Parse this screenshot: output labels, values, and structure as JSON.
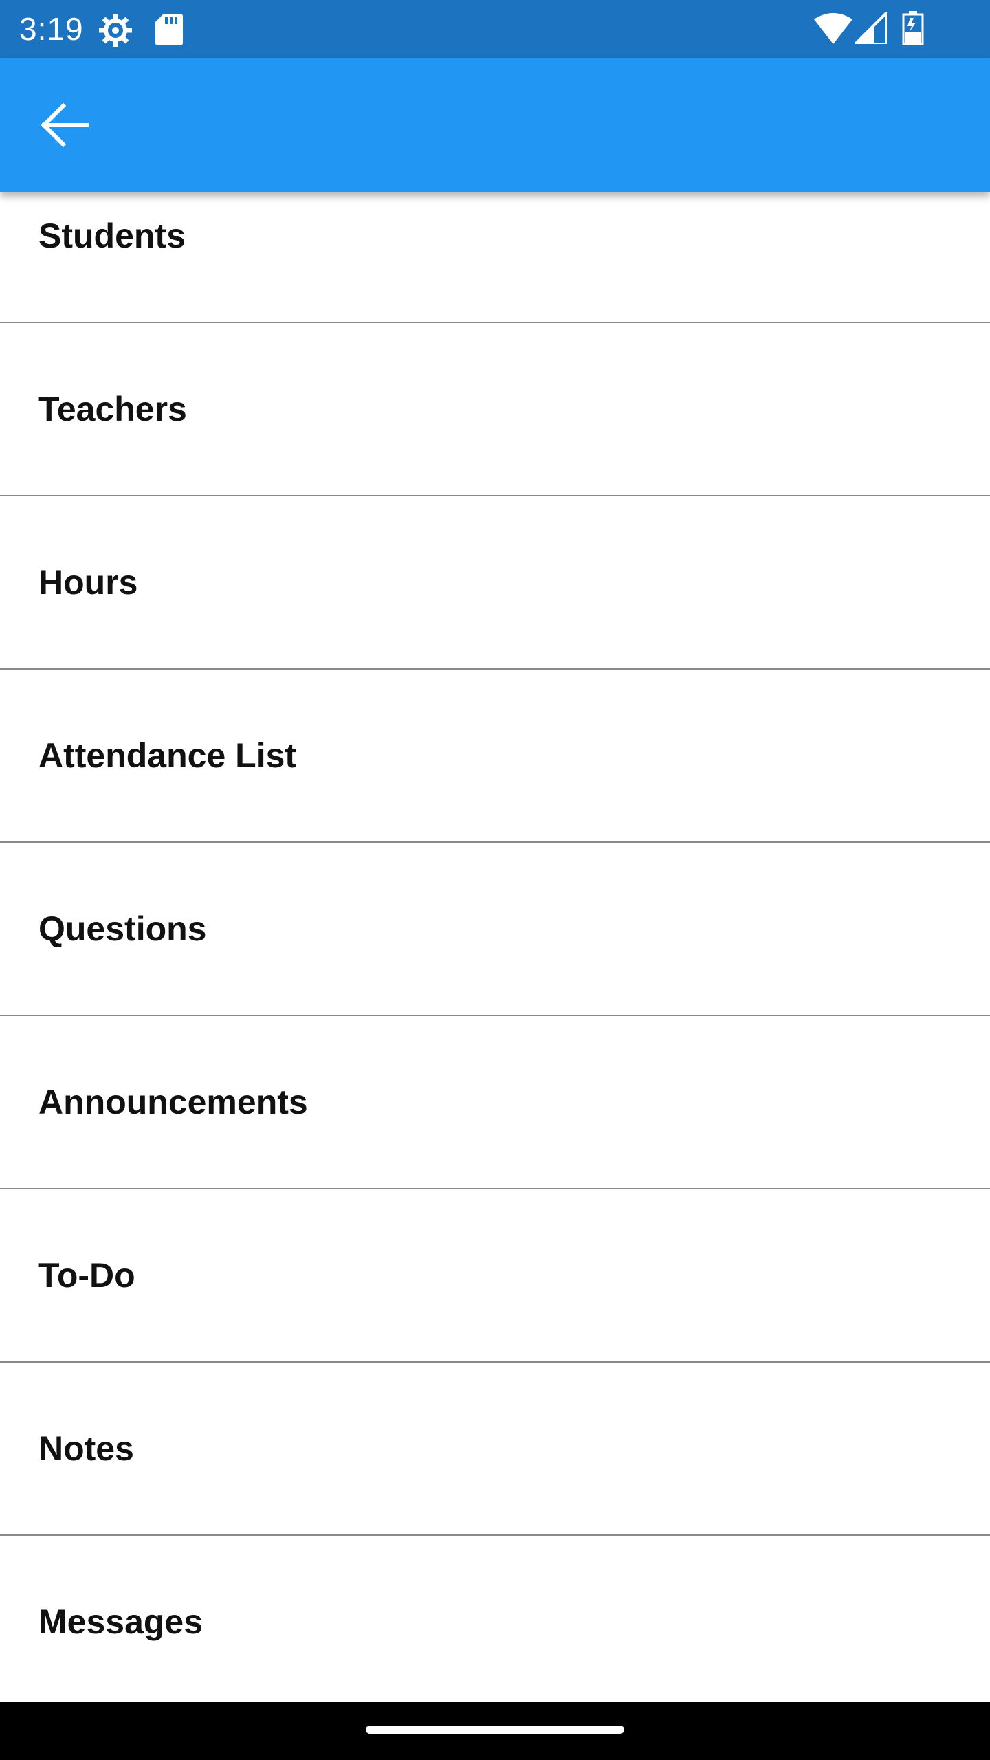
{
  "status_bar": {
    "time": "3:19",
    "icons": [
      "gear-icon",
      "sd-card-icon",
      "wifi-icon",
      "cellular-signal-icon",
      "battery-icon"
    ],
    "background": "#1c73bf"
  },
  "app_bar": {
    "background": "#2196f3",
    "back_icon": "arrow-left-icon"
  },
  "menu": {
    "items": [
      {
        "label": "Students"
      },
      {
        "label": "Teachers"
      },
      {
        "label": "Hours"
      },
      {
        "label": "Attendance List"
      },
      {
        "label": "Questions"
      },
      {
        "label": "Announcements"
      },
      {
        "label": "To-Do"
      },
      {
        "label": "Notes"
      },
      {
        "label": "Messages"
      }
    ]
  },
  "nav_bar": {
    "background": "#000000"
  }
}
